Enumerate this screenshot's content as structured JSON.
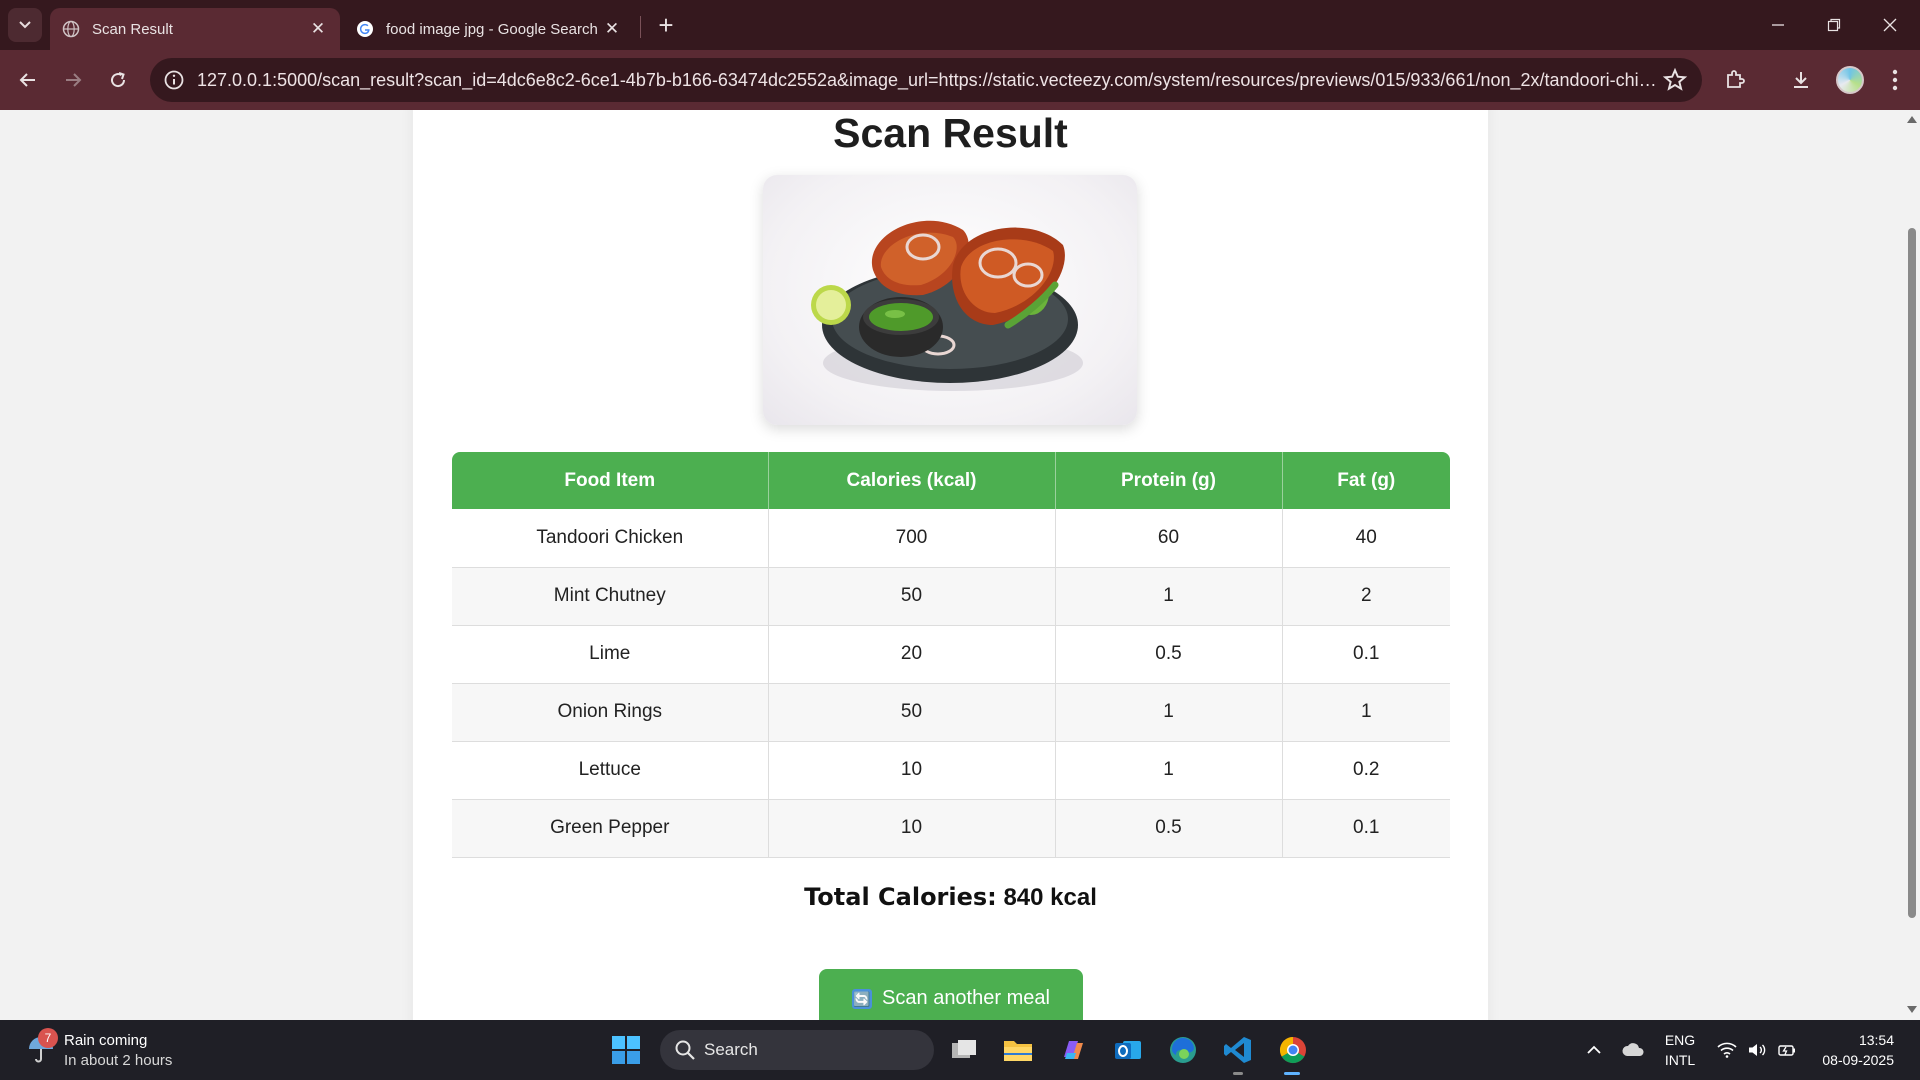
{
  "browser": {
    "tabs": [
      {
        "title": "Scan Result",
        "icon": "globe-icon",
        "active": true
      },
      {
        "title": "food image jpg - Google Search",
        "icon": "google-icon",
        "active": false
      }
    ],
    "url": "127.0.0.1:5000/scan_result?scan_id=4dc6e8c2-6ce1-4b7b-b166-63474dc2552a&image_url=https://static.vecteezy.com/system/resources/previews/015/933/661/non_2x/tandoori-chicken-..."
  },
  "page": {
    "title": "Scan Result",
    "image_alt": "tandoori-chicken",
    "table": {
      "headers": [
        "Food Item",
        "Calories (kcal)",
        "Protein (g)",
        "Fat (g)"
      ],
      "rows": [
        [
          "Tandoori Chicken",
          "700",
          "60",
          "40"
        ],
        [
          "Mint Chutney",
          "50",
          "1",
          "2"
        ],
        [
          "Lime",
          "20",
          "0.5",
          "0.1"
        ],
        [
          "Onion Rings",
          "50",
          "1",
          "1"
        ],
        [
          "Lettuce",
          "10",
          "1",
          "0.2"
        ],
        [
          "Green Pepper",
          "10",
          "0.5",
          "0.1"
        ]
      ]
    },
    "total_label": "Total Calories:",
    "total_value": "840 kcal",
    "scan_button": "Scan another meal",
    "scan_button_icon": "🔄"
  },
  "taskbar": {
    "weather_badge": "7",
    "weather_title": "Rain coming",
    "weather_sub": "In about 2 hours",
    "search_placeholder": "Search",
    "lang_line1": "ENG",
    "lang_line2": "INTL",
    "time": "13:54",
    "date": "08-09-2025"
  },
  "colors": {
    "accent_green": "#4caf50",
    "browser_frame": "#35181e",
    "toolbar": "#5a2a33"
  }
}
